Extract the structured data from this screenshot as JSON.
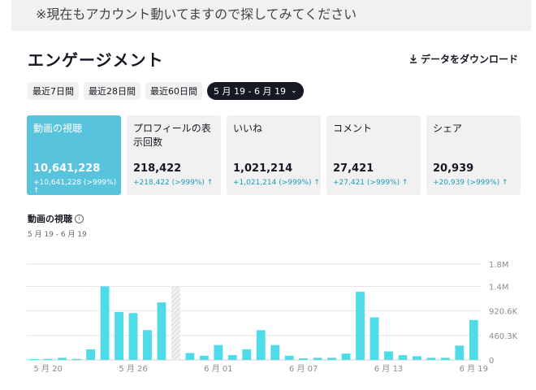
{
  "notice": "※現在もアカウント動いてますので探してみてください",
  "title": "エンゲージメント",
  "download_label": "データをダウンロード",
  "ranges": [
    {
      "label": "最近7日間",
      "active": false
    },
    {
      "label": "最近28日間",
      "active": false
    },
    {
      "label": "最近60日間",
      "active": false
    },
    {
      "label": "5 月 19 - 6 月 19",
      "active": true
    }
  ],
  "cards": [
    {
      "label": "動画の視聴",
      "value": "10,641,228",
      "delta": "+10,641,228 (>999%) ↑",
      "active": true
    },
    {
      "label": "プロフィールの表示回数",
      "value": "218,422",
      "delta": "+218,422 (>999%) ↑",
      "active": false
    },
    {
      "label": "いいね",
      "value": "1,021,214",
      "delta": "+1,021,214 (>999%) ↑",
      "active": false
    },
    {
      "label": "コメント",
      "value": "27,421",
      "delta": "+27,421 (>999%) ↑",
      "active": false
    },
    {
      "label": "シェア",
      "value": "20,939",
      "delta": "+20,939 (>999%) ↑",
      "active": false
    }
  ],
  "chart_section": {
    "title": "動画の視聴",
    "subtitle": "5 月 19 - 6 月 19"
  },
  "chart_data": {
    "type": "bar",
    "ylim": [
      0,
      1800000
    ],
    "yticks": [
      "0",
      "460.3K",
      "920.6K",
      "1.4M",
      "1.8M"
    ],
    "ytick_values": [
      0,
      460300,
      920600,
      1380000,
      1800000
    ],
    "xtick_labels": [
      "5 月 20",
      "5 月 26",
      "6 月 01",
      "6 月 07",
      "6 月 13",
      "6 月 19"
    ],
    "xtick_indices": [
      1,
      7,
      13,
      19,
      25,
      31
    ],
    "bar_color": "#4fdbe8",
    "missing_index": 10,
    "values": [
      10000,
      20000,
      40000,
      20000,
      200000,
      1380000,
      900000,
      880000,
      560000,
      1080000,
      0,
      130000,
      80000,
      280000,
      90000,
      200000,
      560000,
      280000,
      80000,
      30000,
      40000,
      40000,
      120000,
      1280000,
      800000,
      160000,
      90000,
      70000,
      40000,
      40000,
      270000,
      750000
    ]
  }
}
